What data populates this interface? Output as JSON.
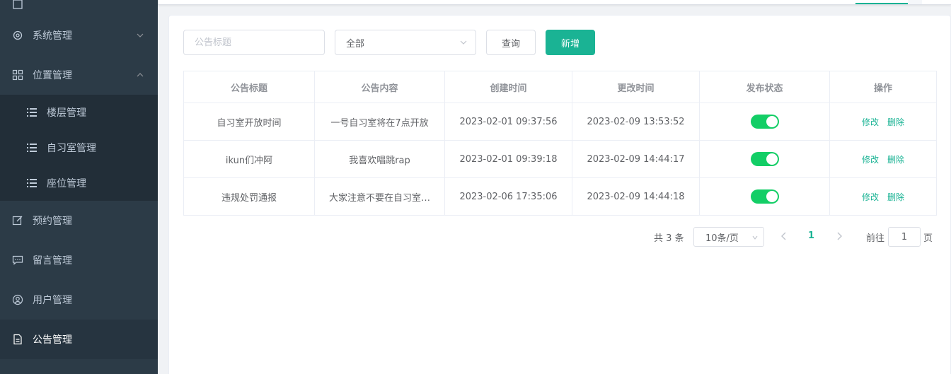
{
  "sidebar": {
    "items": [
      {
        "label": "系统管理",
        "icon": "gear-icon"
      },
      {
        "label": "位置管理",
        "icon": "grid-icon"
      },
      {
        "label": "楼层管理",
        "icon": "list-icon"
      },
      {
        "label": "自习室管理",
        "icon": "list-icon"
      },
      {
        "label": "座位管理",
        "icon": "list-icon"
      },
      {
        "label": "预约管理",
        "icon": "edit-icon"
      },
      {
        "label": "留言管理",
        "icon": "message-icon"
      },
      {
        "label": "用户管理",
        "icon": "user-icon"
      },
      {
        "label": "公告管理",
        "icon": "document-icon"
      }
    ]
  },
  "filters": {
    "title_placeholder": "公告标题",
    "status_selected": "全部",
    "query_label": "查询",
    "add_label": "新增"
  },
  "table": {
    "headers": [
      "公告标题",
      "公告内容",
      "创建时间",
      "更改时间",
      "发布状态",
      "操作"
    ],
    "rows": [
      {
        "title": "自习室开放时间",
        "content": "一号自习室将在7点开放",
        "created": "2023-02-01 09:37:56",
        "updated": "2023-02-09 13:53:52",
        "published": true
      },
      {
        "title": "ikun们冲阿",
        "content": "我喜欢唱跳rap",
        "created": "2023-02-01 09:39:18",
        "updated": "2023-02-09 14:44:17",
        "published": true
      },
      {
        "title": "违规处罚通报",
        "content": "大家注意不要在自习室…",
        "created": "2023-02-06 17:35:06",
        "updated": "2023-02-09 14:44:18",
        "published": true
      }
    ],
    "edit_label": "修改",
    "delete_label": "删除"
  },
  "pagination": {
    "total_text": "共 3 条",
    "page_size": "10条/页",
    "current_page": "1",
    "goto_label": "前往",
    "goto_value": "1",
    "page_suffix": "页"
  },
  "colors": {
    "accent": "#1ab394",
    "switch_on": "#13ce66",
    "sidebar_bg": "#2c3b47"
  }
}
